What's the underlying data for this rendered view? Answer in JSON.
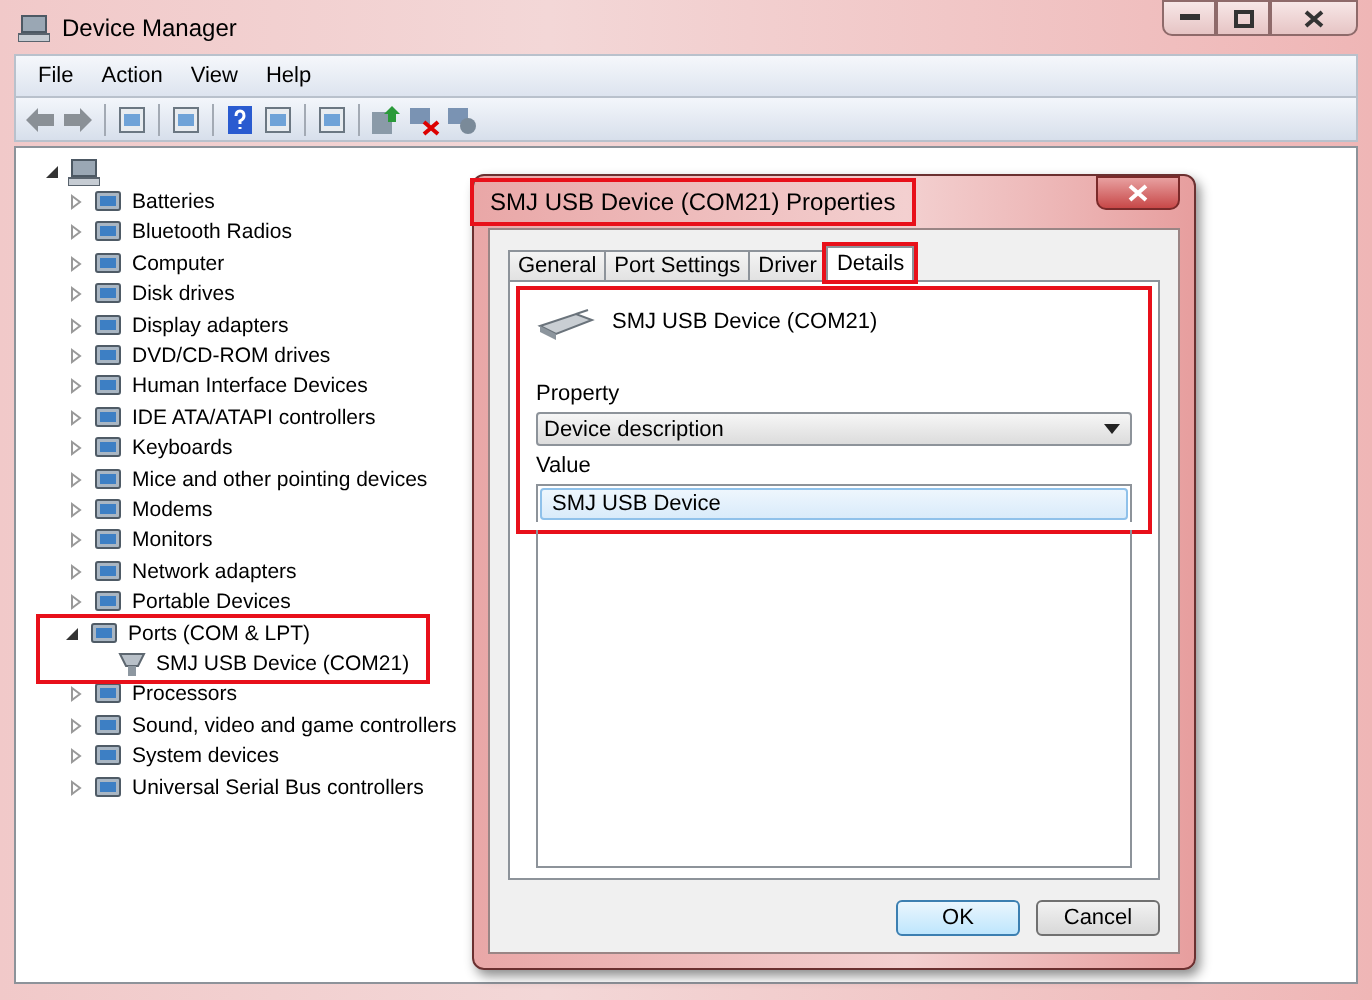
{
  "window": {
    "title": "Device Manager"
  },
  "menu": [
    "File",
    "Action",
    "View",
    "Help"
  ],
  "tree": {
    "expanded": true,
    "children": [
      {
        "label": "Batteries",
        "expanded": false,
        "highlighted": false
      },
      {
        "label": "Bluetooth Radios",
        "expanded": false,
        "highlighted": false
      },
      {
        "label": "Computer",
        "expanded": false,
        "highlighted": false
      },
      {
        "label": "Disk drives",
        "expanded": false,
        "highlighted": false
      },
      {
        "label": "Display adapters",
        "expanded": false,
        "highlighted": false
      },
      {
        "label": "DVD/CD-ROM drives",
        "expanded": false,
        "highlighted": false
      },
      {
        "label": "Human Interface Devices",
        "expanded": false,
        "highlighted": false
      },
      {
        "label": "IDE ATA/ATAPI controllers",
        "expanded": false,
        "highlighted": false
      },
      {
        "label": "Keyboards",
        "expanded": false,
        "highlighted": false
      },
      {
        "label": "Mice and other pointing devices",
        "expanded": false,
        "highlighted": false
      },
      {
        "label": "Modems",
        "expanded": false,
        "highlighted": false
      },
      {
        "label": "Monitors",
        "expanded": false,
        "highlighted": false
      },
      {
        "label": "Network adapters",
        "expanded": false,
        "highlighted": false
      },
      {
        "label": "Portable Devices",
        "expanded": false,
        "highlighted": false
      },
      {
        "label": "Ports (COM & LPT)",
        "expanded": true,
        "highlighted": true,
        "children": [
          {
            "label": "SMJ USB Device (COM21)"
          }
        ]
      },
      {
        "label": "Processors",
        "expanded": false,
        "highlighted": false
      },
      {
        "label": "Sound, video and game controllers",
        "expanded": false,
        "highlighted": false
      },
      {
        "label": "System devices",
        "expanded": false,
        "highlighted": false
      },
      {
        "label": "Universal Serial Bus controllers",
        "expanded": false,
        "highlighted": false
      }
    ]
  },
  "dialog": {
    "title": "SMJ USB Device (COM21) Properties",
    "title_highlighted": true,
    "tabs": [
      {
        "label": "General",
        "selected": false,
        "highlighted": false
      },
      {
        "label": "Port Settings",
        "selected": false,
        "highlighted": false
      },
      {
        "label": "Driver",
        "selected": false,
        "highlighted": false
      },
      {
        "label": "Details",
        "selected": true,
        "highlighted": true
      }
    ],
    "details_highlighted": true,
    "device_name": "SMJ USB Device (COM21)",
    "property_label": "Property",
    "property_value": "Device description",
    "value_label": "Value",
    "values": [
      "SMJ USB Device"
    ],
    "buttons": [
      "OK",
      "Cancel"
    ]
  }
}
